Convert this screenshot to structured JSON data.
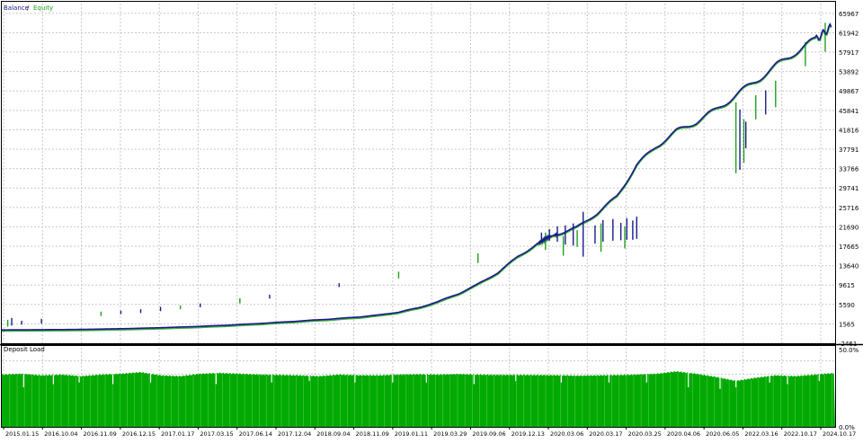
{
  "chart_data": [
    {
      "type": "line",
      "legend": [
        {
          "name": "Balance",
          "color": "#1a1a8c"
        },
        {
          "name": "Equity",
          "color": "#1ea01e"
        }
      ],
      "legend_separator": " / ",
      "legend_placement": "top-left",
      "ylim": [
        -2461,
        67992
      ],
      "y_ticks": [
        "-2461",
        "1565",
        "5590",
        "9615",
        "13640",
        "17665",
        "21690",
        "25716",
        "29741",
        "33766",
        "37791",
        "41816",
        "45841",
        "49867",
        "53892",
        "57917",
        "61942",
        "65967"
      ],
      "grid": true,
      "series": [
        {
          "name": "Balance",
          "color": "#1a1a8c",
          "points": [
            [
              0,
              300
            ],
            [
              2,
              350
            ],
            [
              4,
              410
            ],
            [
              5,
              480
            ],
            [
              6,
              560
            ],
            [
              7,
              650
            ],
            [
              8,
              770
            ],
            [
              9,
              900
            ],
            [
              10,
              1050
            ],
            [
              11,
              1220
            ],
            [
              12,
              1420
            ],
            [
              13,
              1650
            ],
            [
              14,
              1900
            ],
            [
              15,
              2150
            ],
            [
              16,
              2420
            ],
            [
              17,
              2680
            ],
            [
              18,
              3000
            ],
            [
              19,
              3400
            ],
            [
              20,
              4000
            ],
            [
              21,
              4900
            ],
            [
              22,
              6200
            ],
            [
              23,
              7800
            ],
            [
              24,
              9800
            ],
            [
              25,
              12200
            ],
            [
              26,
              15500
            ],
            [
              27,
              18200
            ],
            [
              27.5,
              19500
            ],
            [
              28,
              20200
            ],
            [
              29,
              21600
            ],
            [
              30,
              24500
            ],
            [
              31,
              28000
            ],
            [
              32,
              34500
            ],
            [
              33,
              38500
            ],
            [
              34,
              41500
            ],
            [
              35,
              43500
            ],
            [
              36,
              46000
            ],
            [
              37,
              49000
            ],
            [
              38,
              52000
            ],
            [
              39,
              55000
            ],
            [
              40,
              58000
            ],
            [
              41,
              60500
            ],
            [
              41.8,
              63200
            ]
          ],
          "spikes": [
            [
              0.5,
              1200,
              2800
            ],
            [
              1,
              1400,
              2200
            ],
            [
              2,
              1600,
              2600
            ],
            [
              6,
              3600,
              4300
            ],
            [
              7,
              3800,
              4600
            ],
            [
              8,
              4200,
              5100
            ],
            [
              10,
              5000,
              5800
            ],
            [
              13.5,
              6800,
              7600
            ],
            [
              17,
              9200,
              10000
            ],
            [
              27.2,
              18500,
              20500
            ],
            [
              27.6,
              18800,
              21200
            ],
            [
              28,
              18600,
              21800
            ],
            [
              28.4,
              18000,
              22000
            ],
            [
              28.8,
              17800,
              22400
            ],
            [
              29.3,
              15500,
              24800
            ],
            [
              29.9,
              18200,
              22000
            ],
            [
              30.3,
              18600,
              23100
            ],
            [
              30.8,
              18800,
              23300
            ],
            [
              31.2,
              18900,
              22500
            ],
            [
              31.5,
              19000,
              23500
            ],
            [
              32,
              19200,
              23800
            ],
            [
              31.8,
              19000,
              23000
            ],
            [
              37.2,
              33500,
              46000
            ],
            [
              37.5,
              38000,
              43500
            ],
            [
              38.5,
              45000,
              50000
            ]
          ]
        },
        {
          "name": "Equity",
          "color": "#1ea01e",
          "spikes": [
            [
              0.3,
              1000,
              2400
            ],
            [
              5,
              3200,
              4100
            ],
            [
              9,
              4600,
              5400
            ],
            [
              12,
              5800,
              6900
            ],
            [
              20,
              11000,
              12400
            ],
            [
              24,
              14200,
              16200
            ],
            [
              27.4,
              16900,
              20500
            ],
            [
              28.3,
              15700,
              19800
            ],
            [
              29,
              17500,
              21000
            ],
            [
              30.2,
              16500,
              22400
            ],
            [
              31.4,
              17200,
              21800
            ],
            [
              37,
              32800,
              47500
            ],
            [
              37.4,
              35000,
              44000
            ],
            [
              38,
              44000,
              49000
            ],
            [
              39,
              46500,
              52000
            ],
            [
              40.5,
              55000,
              60000
            ],
            [
              41.5,
              58000,
              64000
            ]
          ]
        }
      ]
    },
    {
      "type": "bar",
      "title": "Deposit Load",
      "y_ticks": [
        "50.0%",
        "0.0%"
      ],
      "ylim": [
        0,
        50
      ],
      "x_tick_labels": [
        "2015.01.15",
        "2016.10.04",
        "2016.11.09",
        "2016.12.15",
        "2017.01.17",
        "2017.03.15",
        "2017.06.14",
        "2017.12.04",
        "2018.09.04",
        "2018.11.09",
        "2019.01.11",
        "2019.03.29",
        "2019.09.06",
        "2019.12.13",
        "2020.03.06",
        "2020.03.17",
        "2020.03.25",
        "2020.04.06",
        "2020.06.05",
        "2022.03.16",
        "2022.10.17",
        "2024.10.17"
      ],
      "color": "#00aa00",
      "load_profile": [
        [
          0,
          33
        ],
        [
          1,
          33.5
        ],
        [
          2,
          32.5
        ],
        [
          3,
          33
        ],
        [
          4,
          32
        ],
        [
          5,
          33
        ],
        [
          6,
          33.5
        ],
        [
          7,
          34.5
        ],
        [
          8,
          32.5
        ],
        [
          9,
          32
        ],
        [
          10,
          33.5
        ],
        [
          11,
          34
        ],
        [
          12,
          33.5
        ],
        [
          13,
          33
        ],
        [
          14,
          32.8
        ],
        [
          15,
          32.5
        ],
        [
          16,
          32
        ],
        [
          17,
          33
        ],
        [
          18,
          32.6
        ],
        [
          19,
          32.5
        ],
        [
          20,
          33
        ],
        [
          21,
          33.2
        ],
        [
          22,
          33
        ],
        [
          23,
          33.3
        ],
        [
          24,
          33
        ],
        [
          25,
          32.8
        ],
        [
          26,
          32.8
        ],
        [
          27,
          32.7
        ],
        [
          28,
          32.6
        ],
        [
          29,
          32.3
        ],
        [
          30,
          32.5
        ],
        [
          31,
          32.7
        ],
        [
          32,
          33
        ],
        [
          33,
          33.5
        ],
        [
          34,
          35
        ],
        [
          35,
          33.5
        ],
        [
          36,
          31.5
        ],
        [
          37,
          29
        ],
        [
          38,
          31
        ],
        [
          39,
          32.5
        ],
        [
          40,
          32
        ],
        [
          41,
          33
        ],
        [
          42,
          34
        ]
      ],
      "dips": [
        [
          1.1,
          25
        ],
        [
          2.6,
          27
        ],
        [
          3.9,
          28
        ],
        [
          5.6,
          27
        ],
        [
          7.5,
          28
        ],
        [
          10.8,
          27
        ],
        [
          13.6,
          28
        ],
        [
          15.5,
          29
        ],
        [
          17.8,
          28
        ],
        [
          19.7,
          28
        ],
        [
          21.4,
          28
        ],
        [
          23.8,
          27
        ],
        [
          25.9,
          29
        ],
        [
          28.2,
          28
        ],
        [
          30.6,
          28
        ],
        [
          32.5,
          28
        ],
        [
          34.6,
          25
        ],
        [
          36.2,
          24
        ],
        [
          37.0,
          25
        ],
        [
          38.7,
          28
        ],
        [
          39.6,
          27
        ],
        [
          41.2,
          29
        ]
      ]
    }
  ]
}
